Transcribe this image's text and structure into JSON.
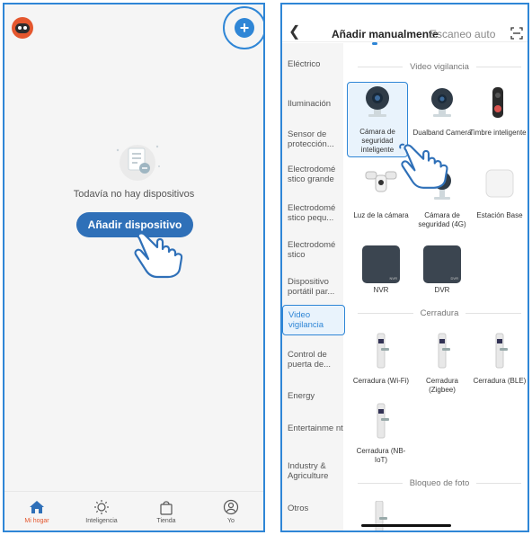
{
  "left": {
    "empty_text": "Todavía no hay dispositivos",
    "add_device_label": "Añadir dispositivo",
    "tabs": [
      {
        "label": "Mi hogar",
        "icon": "home-icon",
        "active": true
      },
      {
        "label": "Inteligencia",
        "icon": "sun-icon",
        "active": false
      },
      {
        "label": "Tienda",
        "icon": "shopping-bag-icon",
        "active": false
      },
      {
        "label": "Yo",
        "icon": "user-icon",
        "active": false
      }
    ],
    "accent_color": "#e4572e",
    "brand_color": "#2f86d6"
  },
  "right": {
    "tab_manual": "Añadir manualmente",
    "tab_auto": "Escaneo auto",
    "categories": [
      {
        "label": "Eléctrico"
      },
      {
        "label": "Iluminación"
      },
      {
        "label": "Sensor de protección..."
      },
      {
        "label": "Electrodomé stico grande"
      },
      {
        "label": "Electrodomé stico pequ..."
      },
      {
        "label": "Electrodomé stico"
      },
      {
        "label": "Dispositivo portátil par..."
      },
      {
        "label": "Video vigilancia",
        "active": true
      },
      {
        "label": "Control de puerta de..."
      },
      {
        "label": "Energy"
      },
      {
        "label": "Entertainme nt"
      },
      {
        "label": "Industry & Agriculture"
      },
      {
        "label": "Otros"
      }
    ],
    "section_video": "Video vigilancia",
    "section_lock": "Cerradura",
    "section_photo_lock": "Bloqueo de foto",
    "video_items": [
      {
        "label": "Cámara de seguridad inteligente",
        "icon": "indoor-camera-icon",
        "selected": true
      },
      {
        "label": "Dualband Camera",
        "icon": "dualband-camera-icon"
      },
      {
        "label": "Timbre inteligente",
        "icon": "doorbell-icon"
      },
      {
        "label": "Luz de la cámara",
        "icon": "floodlight-camera-icon"
      },
      {
        "label": "Cámara de seguridad (4G)",
        "icon": "4g-camera-icon"
      },
      {
        "label": "Estación Base",
        "icon": "base-station-icon"
      },
      {
        "label": "NVR",
        "icon": "nvr-icon"
      },
      {
        "label": "DVR",
        "icon": "dvr-icon"
      }
    ],
    "lock_items": [
      {
        "label": "Cerradura (Wi-Fi)",
        "icon": "lock-icon"
      },
      {
        "label": "Cerradura (Zigbee)",
        "icon": "lock-icon"
      },
      {
        "label": "Cerradura (BLE)",
        "icon": "lock-icon"
      },
      {
        "label": "Cerradura (NB-IoT)",
        "icon": "lock-icon"
      }
    ],
    "nvr_tag": "NVR",
    "dvr_tag": "DVR"
  }
}
